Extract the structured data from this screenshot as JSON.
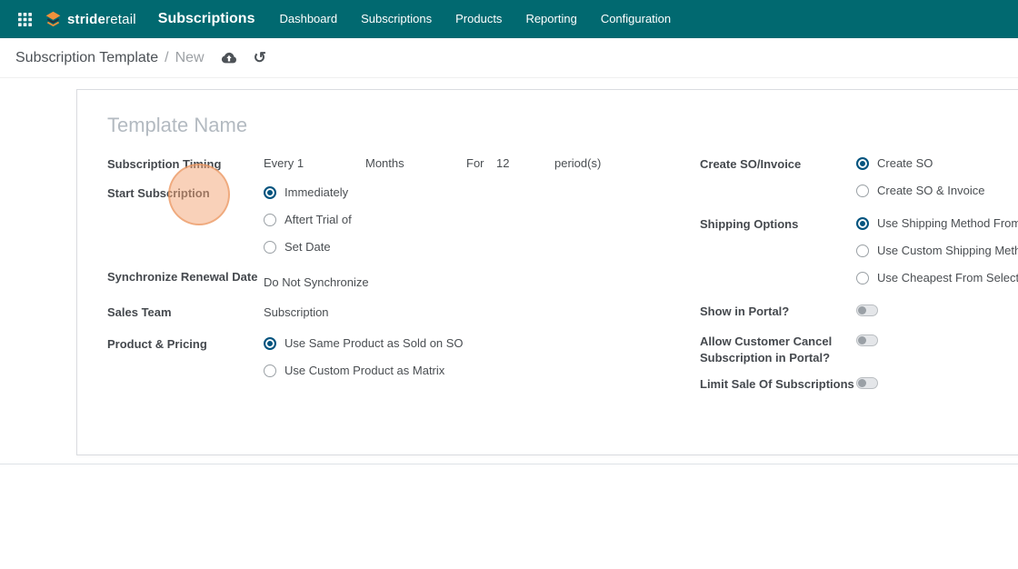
{
  "navbar": {
    "brand_bold": "stride",
    "brand_light": "retail",
    "app_name": "Subscriptions",
    "menu": [
      "Dashboard",
      "Subscriptions",
      "Products",
      "Reporting",
      "Configuration"
    ]
  },
  "breadcrumb": {
    "parent": "Subscription Template",
    "separator": "/",
    "current": "New"
  },
  "sheet": {
    "template_name_placeholder": "Template Name",
    "left": {
      "timing_label": "Subscription Timing",
      "timing_every": "Every 1",
      "timing_unit": "Months",
      "timing_for": "For",
      "timing_count": "12",
      "timing_period": "period(s)",
      "start_label": "Start Subscription",
      "start_options": [
        "Immediately",
        "Aftert Trial of",
        "Set Date"
      ],
      "sync_label": "Synchronize Renewal Date",
      "sync_value": "Do Not Synchronize",
      "sales_team_label": "Sales Team",
      "sales_team_value": "Subscription",
      "product_label": "Product & Pricing",
      "product_options": [
        "Use Same Product as Sold on SO",
        "Use Custom Product as Matrix"
      ]
    },
    "right": {
      "so_label": "Create SO/Invoice",
      "so_options": [
        "Create SO",
        "Create SO & Invoice"
      ],
      "shipping_label": "Shipping Options",
      "shipping_options": [
        "Use Shipping Method From",
        "Use Custom Shipping Metho",
        "Use Cheapest From Selected"
      ],
      "portal_label": "Show in Portal?",
      "cancel_label": "Allow Customer Cancel Subscription in Portal?",
      "limit_label": "Limit Sale Of Subscriptions"
    }
  },
  "colors": {
    "navbar_bg": "#016970",
    "radio_accent": "#02537e",
    "highlight_orange": "#f4a473"
  }
}
